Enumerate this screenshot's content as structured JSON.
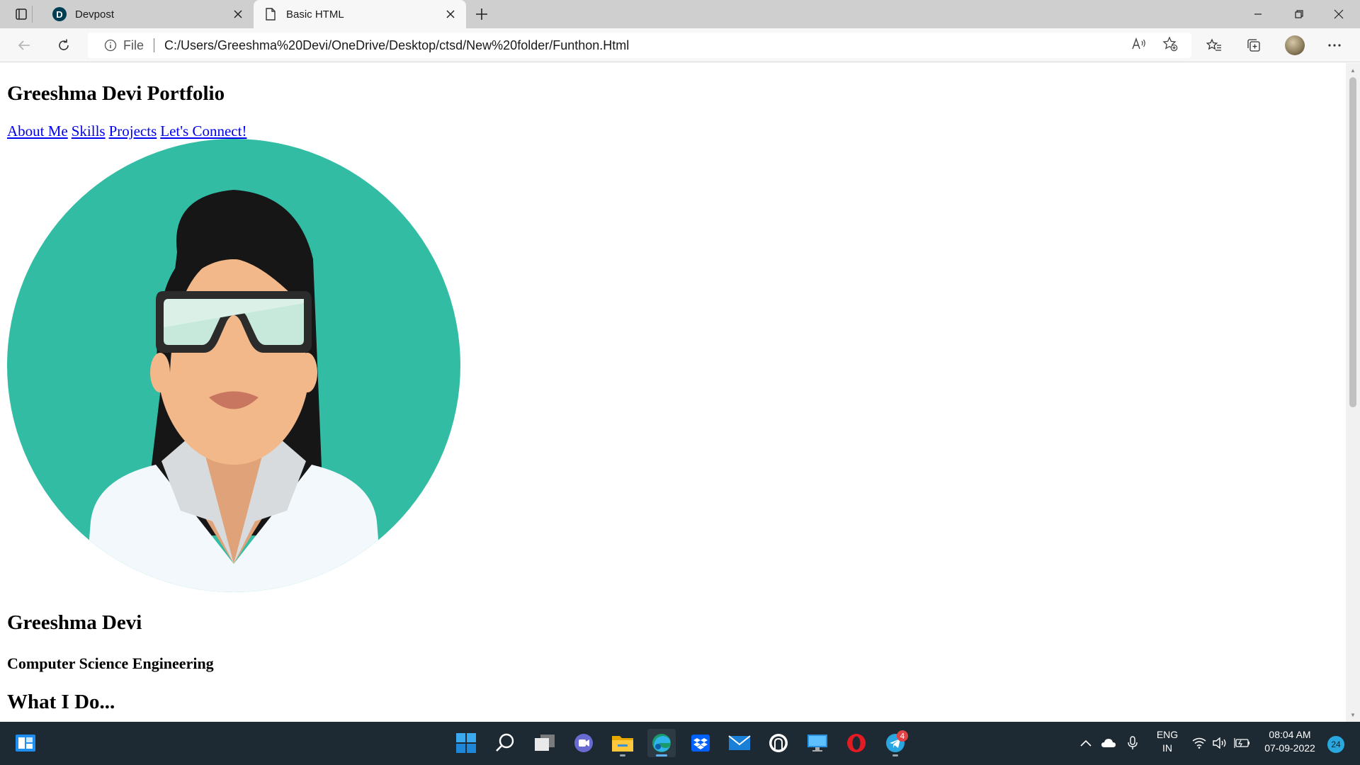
{
  "browser": {
    "tabs": [
      {
        "title": "Devpost",
        "favicon": "devpost-logo",
        "active": false,
        "favicon_letter": "D"
      },
      {
        "title": "Basic HTML",
        "favicon": "document-icon",
        "active": true
      }
    ],
    "address": {
      "protocol_label": "File",
      "url": "C:/Users/Greeshma%20Devi/OneDrive/Desktop/ctsd/New%20folder/Funthon.Html"
    }
  },
  "page": {
    "heading": "Greeshma Devi Portfolio",
    "nav_links": [
      "About Me",
      "Skills",
      "Projects",
      "Let's Connect!"
    ],
    "avatar": {
      "description_icon": "woman-with-goggles-avatar",
      "circle_color": "#32bca4",
      "hair_color": "#161616",
      "skin_color": "#f2b889",
      "goggles_color": "#c7e9dc",
      "coat_color": "#f2f8fc"
    },
    "name": "Greeshma Devi",
    "degree": "Computer Science Engineering",
    "section_heading": "What I Do..."
  },
  "taskbar": {
    "apps": [
      "widgets-icon",
      "start-icon",
      "search-icon",
      "task-view-icon",
      "teams-chat-icon",
      "file-explorer-icon",
      "edge-icon",
      "dropbox-icon",
      "mail-icon",
      "github-icon",
      "remote-desktop-icon",
      "opera-icon",
      "telegram-icon"
    ],
    "telegram_badge": "4",
    "language_line1": "ENG",
    "language_line2": "IN",
    "time": "08:04 AM",
    "date": "07-09-2022",
    "notification_count": "24"
  },
  "colors": {
    "link": "#0000ee",
    "taskbar_bg": "#1e2a33",
    "tabstrip_bg": "#cfcfcf"
  }
}
